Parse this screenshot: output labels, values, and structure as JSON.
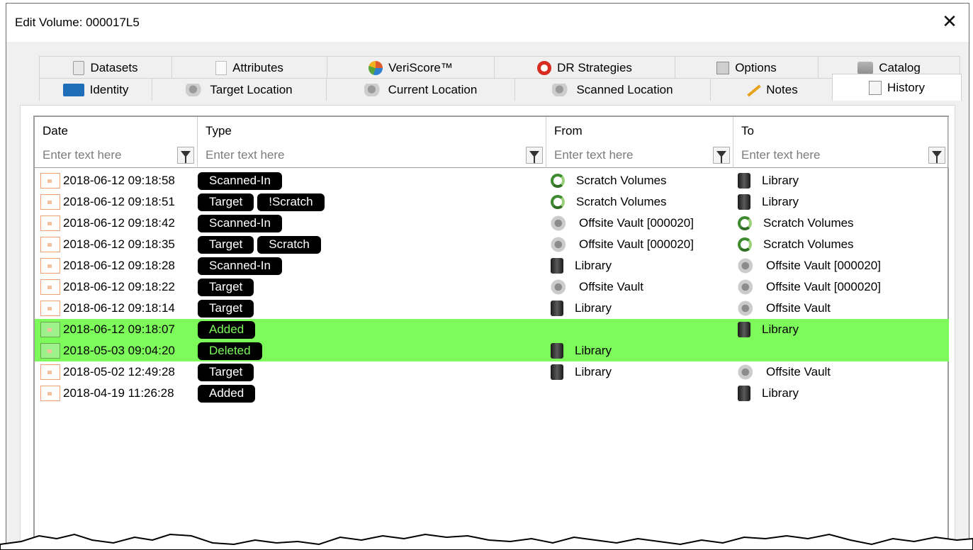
{
  "window": {
    "title": "Edit Volume: 000017L5",
    "close_glyph": "✕"
  },
  "tabs_back": [
    {
      "label": "Datasets",
      "icon": "dataset-icon"
    },
    {
      "label": "Attributes",
      "icon": "attributes-icon"
    },
    {
      "label": "VeriScore™",
      "icon": "veriscore-icon"
    },
    {
      "label": "DR Strategies",
      "icon": "lifebuoy-icon"
    },
    {
      "label": "Options",
      "icon": "options-icon"
    },
    {
      "label": "Catalog",
      "icon": "catalog-icon"
    }
  ],
  "tabs_front": [
    {
      "label": "Identity",
      "icon": "identity-icon"
    },
    {
      "label": "Target Location",
      "icon": "location-icon"
    },
    {
      "label": "Current Location",
      "icon": "location-icon"
    },
    {
      "label": "Scanned Location",
      "icon": "location-icon"
    },
    {
      "label": "Notes",
      "icon": "pencil-icon"
    },
    {
      "label": "History",
      "icon": "calendar-icon",
      "active": true
    }
  ],
  "grid": {
    "columns": [
      {
        "label": "Date",
        "placeholder": "Enter text here"
      },
      {
        "label": "Type",
        "placeholder": "Enter text here"
      },
      {
        "label": "From",
        "placeholder": "Enter text here"
      },
      {
        "label": "To",
        "placeholder": "Enter text here"
      }
    ],
    "rows": [
      {
        "date": "2018-06-12 09:18:58",
        "types": [
          "Scanned-In"
        ],
        "from": {
          "label": "Scratch Volumes",
          "icon": "scratch"
        },
        "to": {
          "label": "Library",
          "icon": "library"
        }
      },
      {
        "date": "2018-06-12 09:18:51",
        "types": [
          "Target",
          "!Scratch"
        ],
        "from": {
          "label": "Scratch Volumes",
          "icon": "scratch"
        },
        "to": {
          "label": "Library",
          "icon": "library"
        }
      },
      {
        "date": "2018-06-12 09:18:42",
        "types": [
          "Scanned-In"
        ],
        "from": {
          "label": "Offsite Vault [000020]",
          "icon": "vault"
        },
        "to": {
          "label": "Scratch Volumes",
          "icon": "scratch"
        }
      },
      {
        "date": "2018-06-12 09:18:35",
        "types": [
          "Target",
          "Scratch"
        ],
        "from": {
          "label": "Offsite Vault [000020]",
          "icon": "vault"
        },
        "to": {
          "label": "Scratch Volumes",
          "icon": "scratch"
        }
      },
      {
        "date": "2018-06-12 09:18:28",
        "types": [
          "Scanned-In"
        ],
        "from": {
          "label": "Library",
          "icon": "library"
        },
        "to": {
          "label": "Offsite Vault [000020]",
          "icon": "vault"
        }
      },
      {
        "date": "2018-06-12 09:18:22",
        "types": [
          "Target"
        ],
        "from": {
          "label": "Offsite Vault",
          "icon": "vault"
        },
        "to": {
          "label": "Offsite Vault [000020]",
          "icon": "vault"
        }
      },
      {
        "date": "2018-06-12 09:18:14",
        "types": [
          "Target"
        ],
        "from": {
          "label": "Library",
          "icon": "library"
        },
        "to": {
          "label": "Offsite Vault",
          "icon": "vault"
        }
      },
      {
        "date": "2018-06-12 09:18:07",
        "types": [
          "Added"
        ],
        "from": null,
        "to": {
          "label": "Library",
          "icon": "library"
        },
        "highlight": true
      },
      {
        "date": "2018-05-03 09:04:20",
        "types": [
          "Deleted"
        ],
        "from": {
          "label": "Library",
          "icon": "library"
        },
        "to": null,
        "highlight": true
      },
      {
        "date": "2018-05-02 12:49:28",
        "types": [
          "Target"
        ],
        "from": {
          "label": "Library",
          "icon": "library"
        },
        "to": {
          "label": "Offsite Vault",
          "icon": "vault"
        }
      },
      {
        "date": "2018-04-19 11:26:28",
        "types": [
          "Added"
        ],
        "from": null,
        "to": {
          "label": "Library",
          "icon": "library"
        }
      }
    ]
  },
  "colors": {
    "highlight": "#7dfb5b",
    "badge": "#000000"
  }
}
